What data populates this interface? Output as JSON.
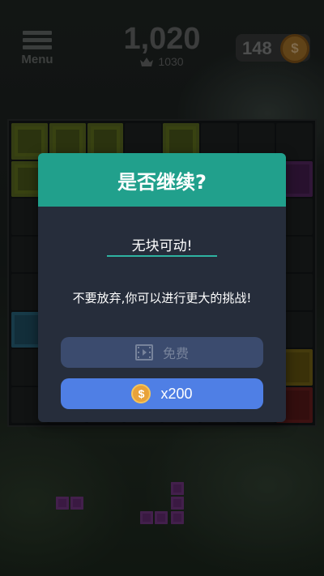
{
  "topbar": {
    "menu_label": "Menu",
    "score": "1,020",
    "best_score": "1030",
    "coins": "148",
    "coin_symbol": "$"
  },
  "board": {
    "columns": 8,
    "rows": 8,
    "cells": [
      "g",
      "g",
      "g",
      ".",
      "g",
      ".",
      ".",
      ".",
      "g",
      ".",
      ".",
      ".",
      ".",
      ".",
      ".",
      "p",
      ".",
      ".",
      ".",
      ".",
      ".",
      ".",
      ".",
      ".",
      ".",
      ".",
      ".",
      ".",
      ".",
      ".",
      ".",
      ".",
      ".",
      ".",
      ".",
      ".",
      ".",
      ".",
      ".",
      ".",
      "b",
      ".",
      ".",
      ".",
      ".",
      ".",
      ".",
      ".",
      ".",
      ".",
      ".",
      ".",
      ".",
      ".",
      ".",
      "y",
      ".",
      ".",
      ".",
      ".",
      ".",
      ".",
      ".",
      "r"
    ],
    "block_colors": {
      "g": "#5f7023",
      "p": "#5a2a66",
      "b": "#2a6a84",
      "y": "#7c6a18",
      "r": "#702222"
    }
  },
  "dialog": {
    "title": "是否继续?",
    "status": "无块可动!",
    "message": "不要放弃,你可以进行更大的挑战!",
    "free_button_label": "免费",
    "free_button_icon": "video-icon",
    "coin_button_label": "x200",
    "coin_button_symbol": "$",
    "colors": {
      "header": "#21a08c",
      "body": "#262d3b",
      "free_button": "#3b4b6e",
      "coin_button": "#4f7fe5"
    }
  }
}
